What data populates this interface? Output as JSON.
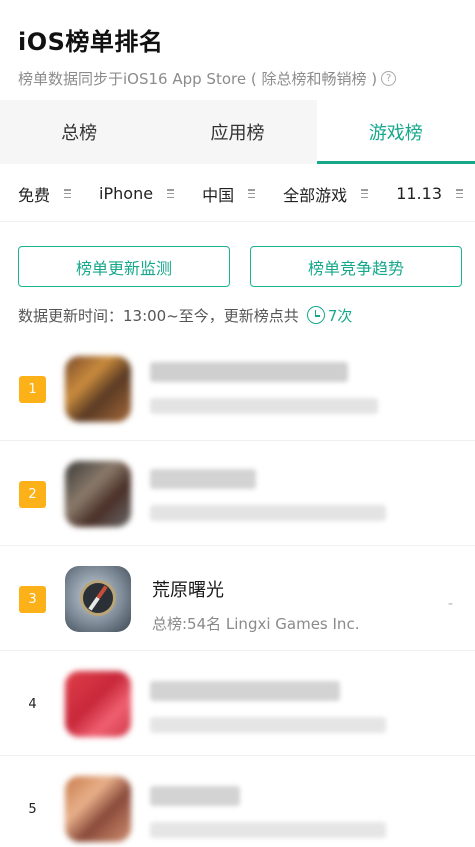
{
  "header": {
    "title": "iOS榜单排名",
    "subtitle": "榜单数据同步于iOS16 App Store ( 除总榜和畅销榜 )",
    "help_glyph": "?"
  },
  "tabs": [
    {
      "label": "总榜",
      "active": false
    },
    {
      "label": "应用榜",
      "active": false
    },
    {
      "label": "游戏榜",
      "active": true
    }
  ],
  "filters": [
    {
      "label": "免费"
    },
    {
      "label": "iPhone"
    },
    {
      "label": "中国"
    },
    {
      "label": "全部游戏"
    },
    {
      "label": "11.13"
    }
  ],
  "actions": {
    "monitor_label": "榜单更新监测",
    "trend_label": "榜单竞争趋势"
  },
  "update_info": {
    "text": "数据更新时间：13:00~至今，更新榜点共",
    "count": "7次"
  },
  "rankings": [
    {
      "rank": "1",
      "name": "",
      "meta": "",
      "blurred": true
    },
    {
      "rank": "2",
      "name": "",
      "meta": "",
      "blurred": true
    },
    {
      "rank": "3",
      "name": "荒原曙光",
      "meta": "总榜:54名  Lingxi Games Inc.",
      "change": "-",
      "blurred": false
    },
    {
      "rank": "4",
      "name": "",
      "meta": "",
      "blurred": true
    },
    {
      "rank": "5",
      "name": "",
      "meta": "",
      "blurred": true
    }
  ],
  "colors": {
    "accent": "#17a88c",
    "rank_badge": "#fbb117",
    "tab_bar_bg": "#f6f6f6"
  },
  "icons": {
    "help": "question-circle-icon",
    "clock": "clock-icon",
    "filter_menu": "menu-lines-icon"
  }
}
